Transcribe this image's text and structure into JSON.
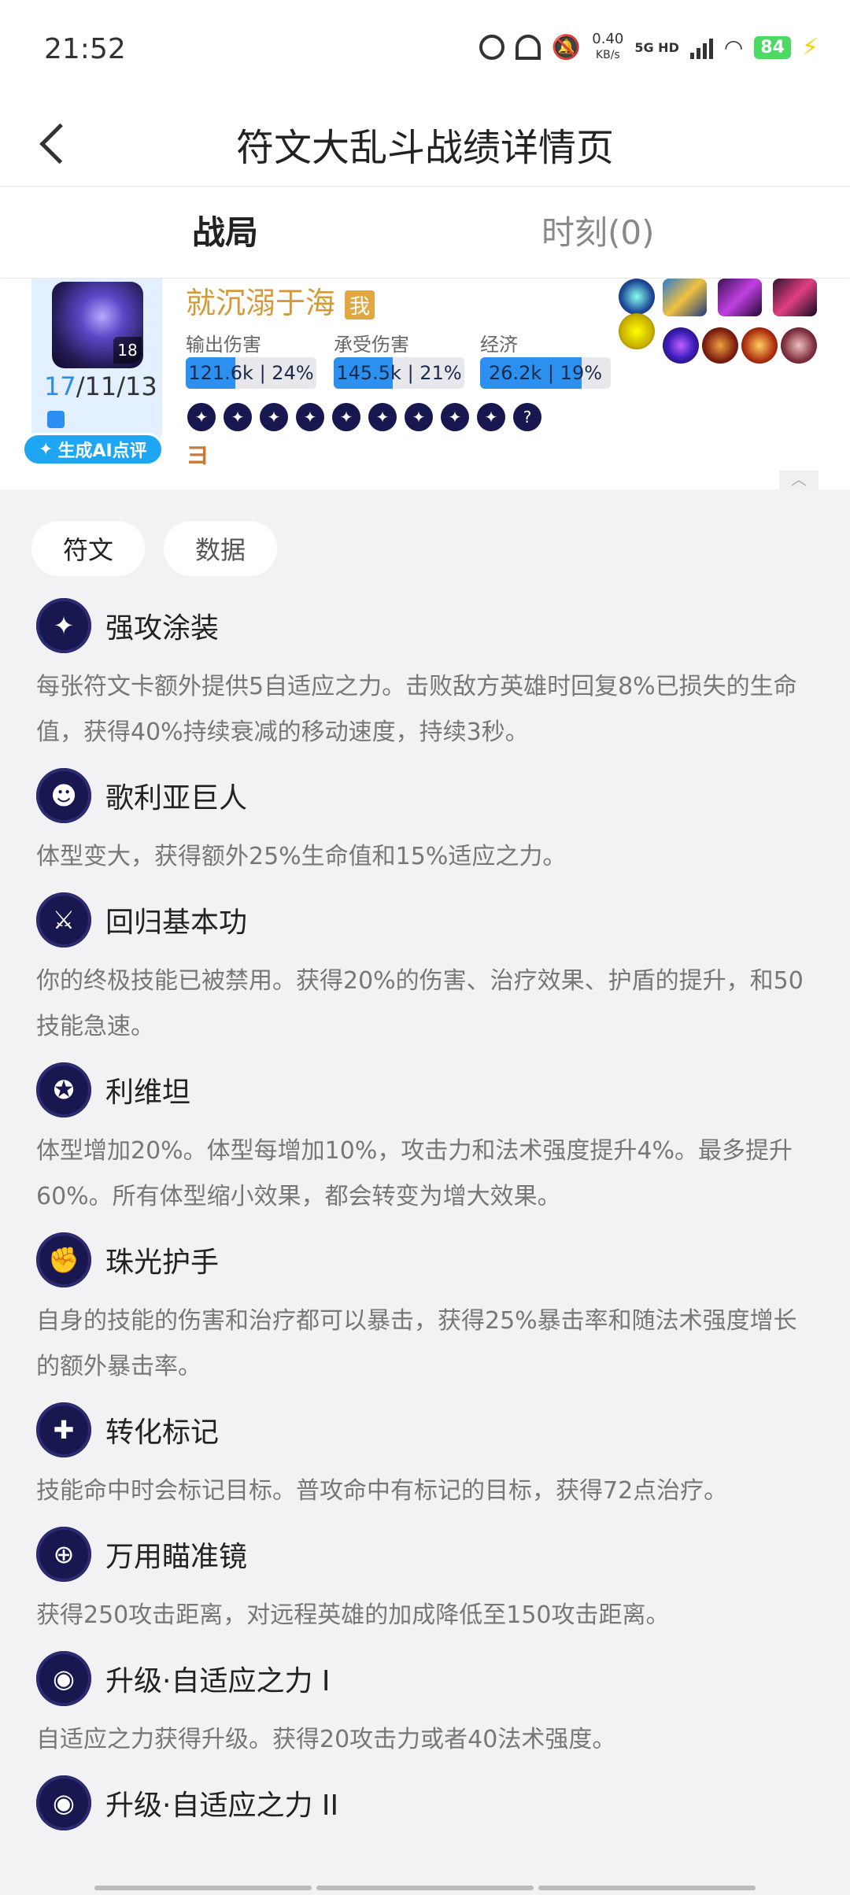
{
  "status_bar": {
    "time": "21:52",
    "net_speed_value": "0.40",
    "net_speed_unit": "KB/s",
    "network": "5G HD",
    "battery": "84"
  },
  "header": {
    "title": "符文大乱斗战绩详情页"
  },
  "tabs": [
    {
      "label": "战局",
      "active": true
    },
    {
      "label": "时刻(0)",
      "active": false
    }
  ],
  "player": {
    "name": "就沉溺于海",
    "me_badge": "我",
    "level": "18",
    "kda_kills": "17",
    "kda_rest": "/11/13",
    "ai_button": "生成AI点评",
    "tier_mark": "ヨ",
    "stats": [
      {
        "label": "输出伤害",
        "value": "121.6k",
        "percent": "24%",
        "fill": 0.38
      },
      {
        "label": "承受伤害",
        "value": "145.5k",
        "percent": "21%",
        "fill": 0.45
      },
      {
        "label": "经济",
        "value": "26.2k",
        "percent": "19%",
        "fill": 0.78
      }
    ],
    "small_runes": [
      "rune-1",
      "rune-2",
      "rune-3",
      "rune-4",
      "rune-5",
      "rune-6",
      "rune-7",
      "rune-8",
      "rune-9",
      "rune-10"
    ],
    "small_rune_last_text": "?"
  },
  "sub_tabs": [
    {
      "label": "符文",
      "active": true
    },
    {
      "label": "数据",
      "active": false
    }
  ],
  "runes": [
    {
      "icon": "scroll-rune-icon",
      "glyph": "✦",
      "name": "强攻涂装",
      "desc": "每张符文卡额外提供5自适应之力。击败敌方英雄时回复8%已损失的生命值，获得40%持续衰减的移动速度，持续3秒。"
    },
    {
      "icon": "goliath-rune-icon",
      "glyph": "☻",
      "name": "歌利亚巨人",
      "desc": "体型变大，获得额外25%生命值和15%适应之力。"
    },
    {
      "icon": "sword-rune-icon",
      "glyph": "⚔",
      "name": "回归基本功",
      "desc": "你的终极技能已被禁用。获得20%的伤害、治疗效果、护盾的提升，和50技能急速。"
    },
    {
      "icon": "leviathan-rune-icon",
      "glyph": "✪",
      "name": "利维坦",
      "desc": "体型增加20%。体型每增加10%，攻击力和法术强度提升4%。最多提升60%。所有体型缩小效果，都会转变为增大效果。"
    },
    {
      "icon": "gauntlet-rune-icon",
      "glyph": "✊",
      "name": "珠光护手",
      "desc": "自身的技能的伤害和治疗都可以暴击，获得25%暴击率和随法术强度增长的额外暴击率。"
    },
    {
      "icon": "mark-rune-icon",
      "glyph": "✚",
      "name": "转化标记",
      "desc": "技能命中时会标记目标。普攻命中有标记的目标，获得72点治疗。"
    },
    {
      "icon": "crosshair-rune-icon",
      "glyph": "⊕",
      "name": "万用瞄准镜",
      "desc": "获得250攻击距离，对远程英雄的加成降低至150攻击距离。"
    },
    {
      "icon": "adaptive-rune-icon",
      "glyph": "◉",
      "name": "升级·自适应之力 I",
      "desc": "自适应之力获得升级。获得20攻击力或者40法术强度。"
    },
    {
      "icon": "adaptive-rune-icon",
      "glyph": "◉",
      "name": "升级·自适应之力 II",
      "desc": ""
    }
  ]
}
